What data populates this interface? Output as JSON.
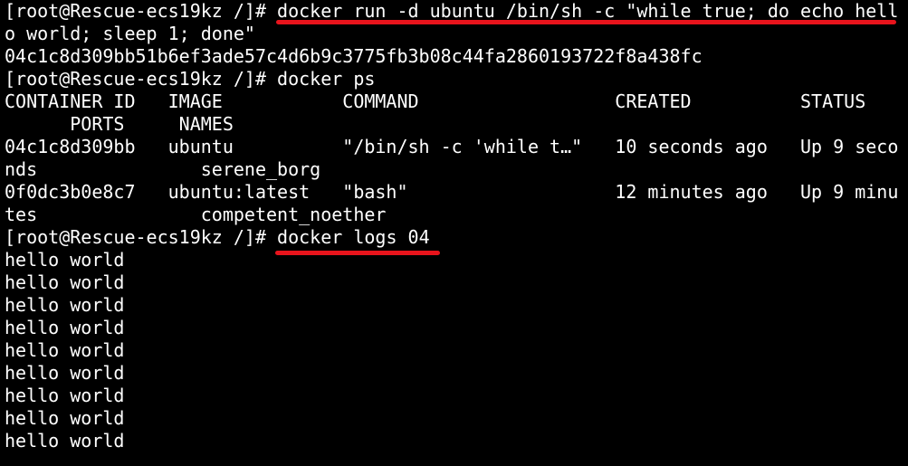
{
  "terminal": {
    "colors": {
      "background": "#000000",
      "foreground": "#ffffff",
      "highlight": "#e8141c"
    },
    "prompt": "[root@Rescue-ecs19kz /]# ",
    "commands": {
      "run_part1": "docker run -d ubuntu /bin/sh -c \"while true; do echo hell",
      "run_part2": "o world; sleep 1; done\"",
      "ps": "docker ps",
      "logs": "docker logs 04"
    },
    "container_hash": "04c1c8d309bb51b6ef3ade57c4d6b9c3775fb3b08c44fa2860193722f8a438fc",
    "ps_table": {
      "header_line1": "CONTAINER ID   IMAGE           COMMAND                  CREATED          STATUS",
      "header_line2": "      PORTS     NAMES",
      "rows": [
        {
          "line1": "04c1c8d309bb   ubuntu          \"/bin/sh -c 'while t…\"   10 seconds ago   Up 9 seco",
          "line2": "nds               serene_borg"
        },
        {
          "line1": "0f0dc3b0e8c7   ubuntu:latest   \"bash\"                   12 minutes ago   Up 9 minu",
          "line2": "tes               competent_noether"
        }
      ]
    },
    "log_output": [
      "hello world",
      "hello world",
      "hello world",
      "hello world",
      "hello world",
      "hello world",
      "hello world",
      "hello world",
      "hello world"
    ]
  }
}
